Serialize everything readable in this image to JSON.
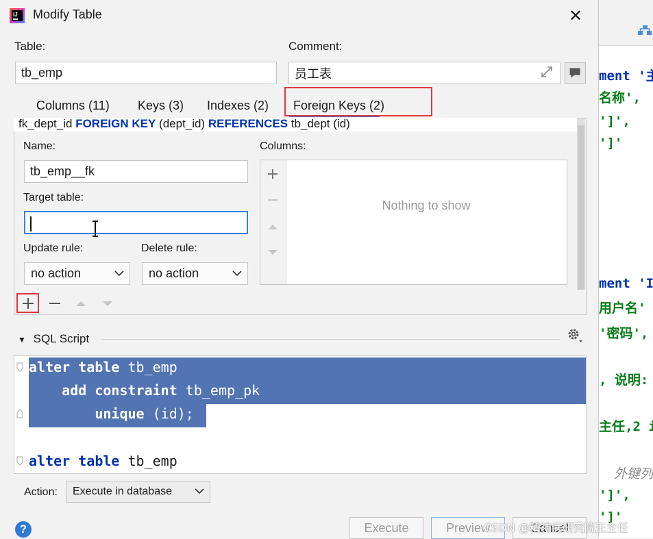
{
  "dialog": {
    "title": "Modify Table",
    "table_label": "Table:",
    "table_value": "tb_emp",
    "comment_label": "Comment:",
    "comment_value": "员工表",
    "tabs": [
      {
        "label": "Columns (11)"
      },
      {
        "label": "Keys (3)"
      },
      {
        "label": "Indexes (2)"
      },
      {
        "label": "Foreign Keys (2)",
        "selected": true
      }
    ],
    "fk_list_row": {
      "name": "fk_dept_id",
      "kw1": "FOREIGN KEY",
      "cols": "(dept_id)",
      "kw2": "REFERENCES",
      "target": "tb_dept (id)"
    },
    "fk_form": {
      "name_label": "Name:",
      "name_value": "tb_emp__fk",
      "target_label": "Target table:",
      "target_value": "",
      "update_label": "Update rule:",
      "update_value": "no action",
      "delete_label": "Delete rule:",
      "delete_value": "no action",
      "columns_label": "Columns:",
      "columns_empty": "Nothing to show"
    },
    "sql": {
      "header": "SQL Script",
      "lines": [
        {
          "kw": "alter table",
          "rest": " tb_emp"
        },
        {
          "kw": "    add constraint",
          "rest": " tb_emp_pk"
        },
        {
          "kw": "        unique",
          "rest": " (id);"
        },
        {
          "kw": "",
          "rest": ""
        },
        {
          "kw": "alter table",
          "rest": " tb_emp"
        }
      ]
    },
    "action_label": "Action:",
    "action_value": "Execute in database",
    "buttons": {
      "execute": "Execute",
      "preview": "Preview",
      "cancel": "Cancel"
    },
    "help": "?"
  },
  "background_editor": {
    "lines": [
      {
        "text": "ment '主",
        "cls": "blue"
      },
      {
        "text": "名称',",
        "cls": ""
      },
      {
        "text": "']',",
        "cls": ""
      },
      {
        "text": "']'",
        "cls": ""
      },
      {
        "text": "ment 'I",
        "cls": "blue"
      },
      {
        "text": "用户名'",
        "cls": ""
      },
      {
        "text": "'密码',",
        "cls": ""
      },
      {
        "text": ", 说明:",
        "cls": ""
      },
      {
        "text": "主任,2 i",
        "cls": ""
      },
      {
        "text": "外键列",
        "cls": "gray"
      },
      {
        "text": "']',",
        "cls": ""
      },
      {
        "text": "']'",
        "cls": ""
      }
    ]
  },
  "watermark": "CSDN @精神病研究院王主任",
  "colors": {
    "selection": "#5274b3",
    "tab_underline": "#3c74d8",
    "highlight_box": "#e0383e",
    "keyword": "#0033b3",
    "string": "#067d17"
  }
}
